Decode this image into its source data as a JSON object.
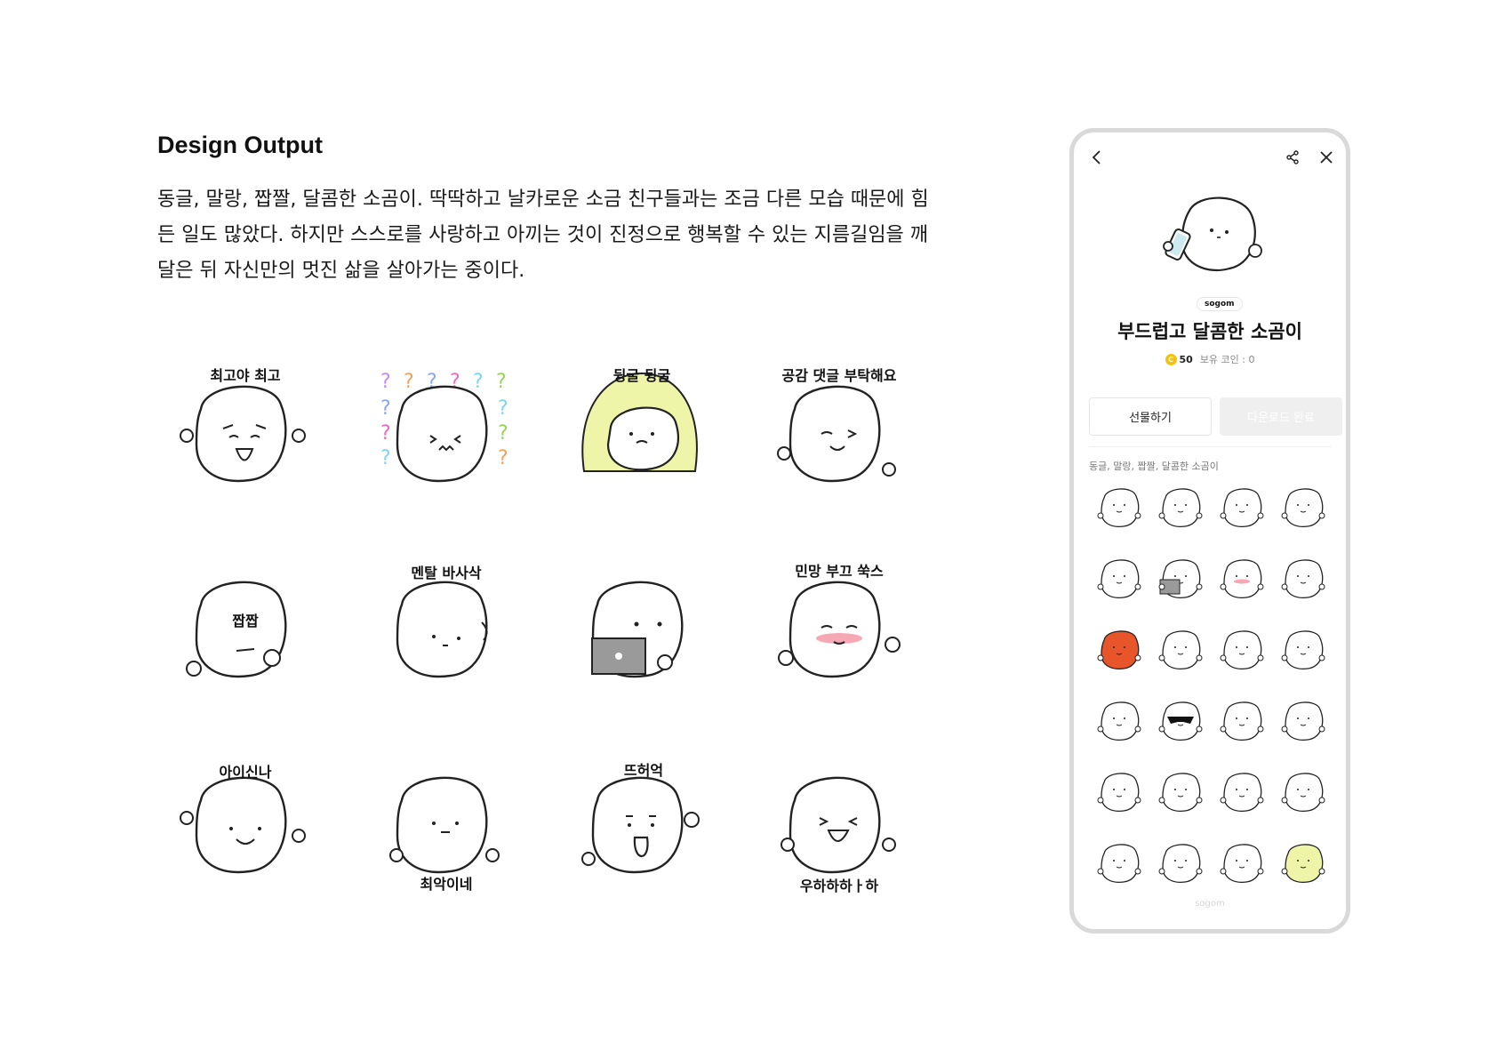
{
  "section": {
    "title": "Design Output",
    "description": "동글, 말랑, 짭짤, 달콤한 소곰이. 딱딱하고 날카로운 소금 친구들과는 조금 다른 모습 때문에 힘든 일도 많았다. 하지만 스스로를 사랑하고 아끼는 것이 진정으로 행복할 수 있는 지름길임을 깨달은 뒤 자신만의 멋진 삶을 살아가는 중이다."
  },
  "stickers": [
    {
      "caption": "최고야 최고",
      "mood": "happy"
    },
    {
      "caption": "",
      "mood": "confused-question-marks"
    },
    {
      "caption": "뒹굴 뒹굴",
      "mood": "blanket"
    },
    {
      "caption": "공감 댓글 부탁해요",
      "mood": "wink"
    },
    {
      "caption": "짭짭",
      "mood": "chewing"
    },
    {
      "caption": "멘탈 바사삭",
      "mood": "broken"
    },
    {
      "caption": "",
      "mood": "laptop"
    },
    {
      "caption": "민망 부끄 쑥스",
      "mood": "blush"
    },
    {
      "caption": "아이신나",
      "mood": "excited-music"
    },
    {
      "caption": "최악이네",
      "mood": "sad"
    },
    {
      "caption": "뜨허억",
      "mood": "shocked"
    },
    {
      "caption": "우하하하ㅏ하",
      "mood": "laugh"
    }
  ],
  "phone": {
    "back_icon": "chevron-left-icon",
    "share_icon": "share-icon",
    "close_icon": "close-icon",
    "brand": "sogom",
    "pack_title": "부드럽고 달콤한 소곰이",
    "coin_symbol": "C",
    "price": "50",
    "owned_coins": "보유 코인 : 0",
    "gift_button": "선물하기",
    "download_button": "다운로드 완료",
    "pack_description": "동글, 말랑, 짭짤, 달콤한 소곰이",
    "footer": "sogom",
    "mini_stickers": [
      "neutral",
      "teary",
      "fork",
      "sleepy",
      "phone",
      "laptop",
      "blush",
      "crying",
      "angry-red",
      "happy",
      "calm",
      "question",
      "speech",
      "sunglasses",
      "sparkle",
      "smile",
      "heart",
      "shocked",
      "laugh",
      "music",
      "side",
      "pout",
      "hug",
      "blanket"
    ]
  },
  "colors": {
    "blanket": "#eef5a8",
    "blush": "#f7a8b5",
    "coin": "#f4c20d",
    "laptop": "#9a9a9a",
    "angry": "#e8552a"
  }
}
